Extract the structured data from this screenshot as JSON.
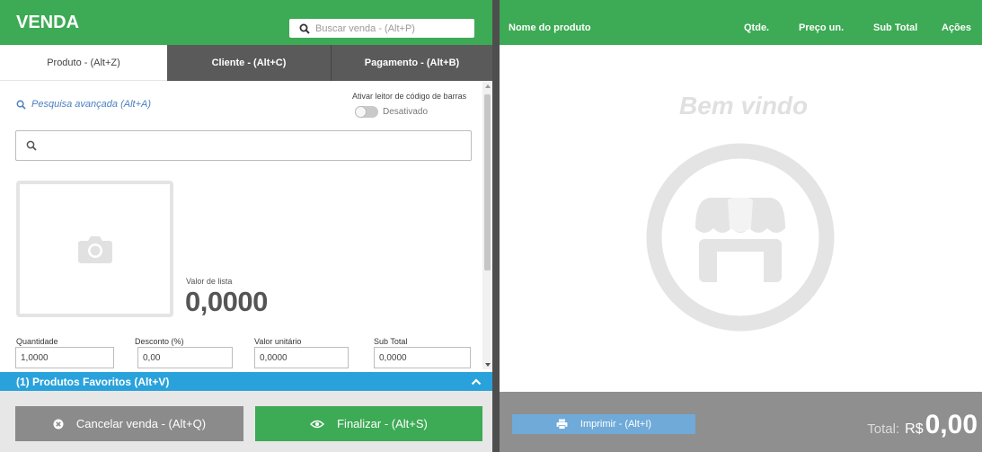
{
  "left": {
    "title": "VENDA",
    "search_placeholder": "Buscar venda - (Alt+P)",
    "tabs": [
      {
        "label": "Produto - (Alt+Z)",
        "active": true
      },
      {
        "label": "Cliente - (Alt+C)",
        "active": false
      },
      {
        "label": "Pagamento - (Alt+B)",
        "active": false
      }
    ],
    "advanced_search": "Pesquisa avançada (Alt+A)",
    "barcode_label": "Ativar leitor de código de barras",
    "barcode_state": "Desativado",
    "list_price_label": "Valor de lista",
    "list_price_value": "0,0000",
    "fields": [
      {
        "label": "Quantidade",
        "value": "1,0000"
      },
      {
        "label": "Desconto (%)",
        "value": "0,00"
      },
      {
        "label": "Valor unitário",
        "value": "0,0000"
      },
      {
        "label": "Sub Total",
        "value": "0,0000"
      }
    ],
    "favorites": "(1) Produtos Favoritos (Alt+V)",
    "cancel_label": "Cancelar venda - (Alt+Q)",
    "finish_label": "Finalizar - (Alt+S)"
  },
  "right": {
    "columns": {
      "product": "Nome do produto",
      "qty": "Qtde.",
      "unit_price": "Preço un.",
      "subtotal": "Sub Total",
      "actions": "Ações"
    },
    "welcome": "Bem vindo",
    "print_label": "Imprimir - (Alt+I)",
    "total_label": "Total:",
    "total_currency": "R$",
    "total_value": "0,00"
  },
  "colors": {
    "green": "#3daa55",
    "blue": "#29a2dc",
    "dark": "#4e4e4e",
    "footer_gray": "#8f8f8f",
    "cancel_gray": "#8b8b8b",
    "print_blue": "#6faad8"
  },
  "icons": [
    "search-icon",
    "camera-icon",
    "chevron-up-icon",
    "times-circle-icon",
    "eye-icon",
    "print-icon",
    "store-icon"
  ]
}
